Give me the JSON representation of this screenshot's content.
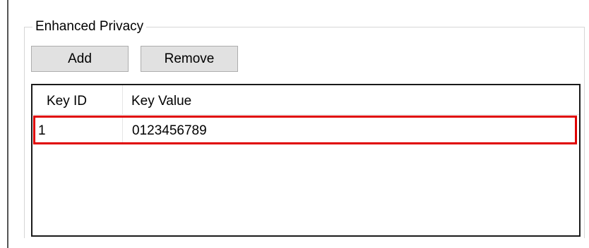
{
  "group": {
    "title": "Enhanced Privacy"
  },
  "toolbar": {
    "add_label": "Add",
    "remove_label": "Remove"
  },
  "table": {
    "columns": [
      "Key ID",
      "Key Value"
    ],
    "rows": [
      {
        "key_id": "1",
        "key_value": "0123456789",
        "highlighted": true
      }
    ]
  },
  "colors": {
    "highlight": "#e00000",
    "button_bg": "#e1e1e1",
    "grid_border": "#1a1a1a"
  }
}
